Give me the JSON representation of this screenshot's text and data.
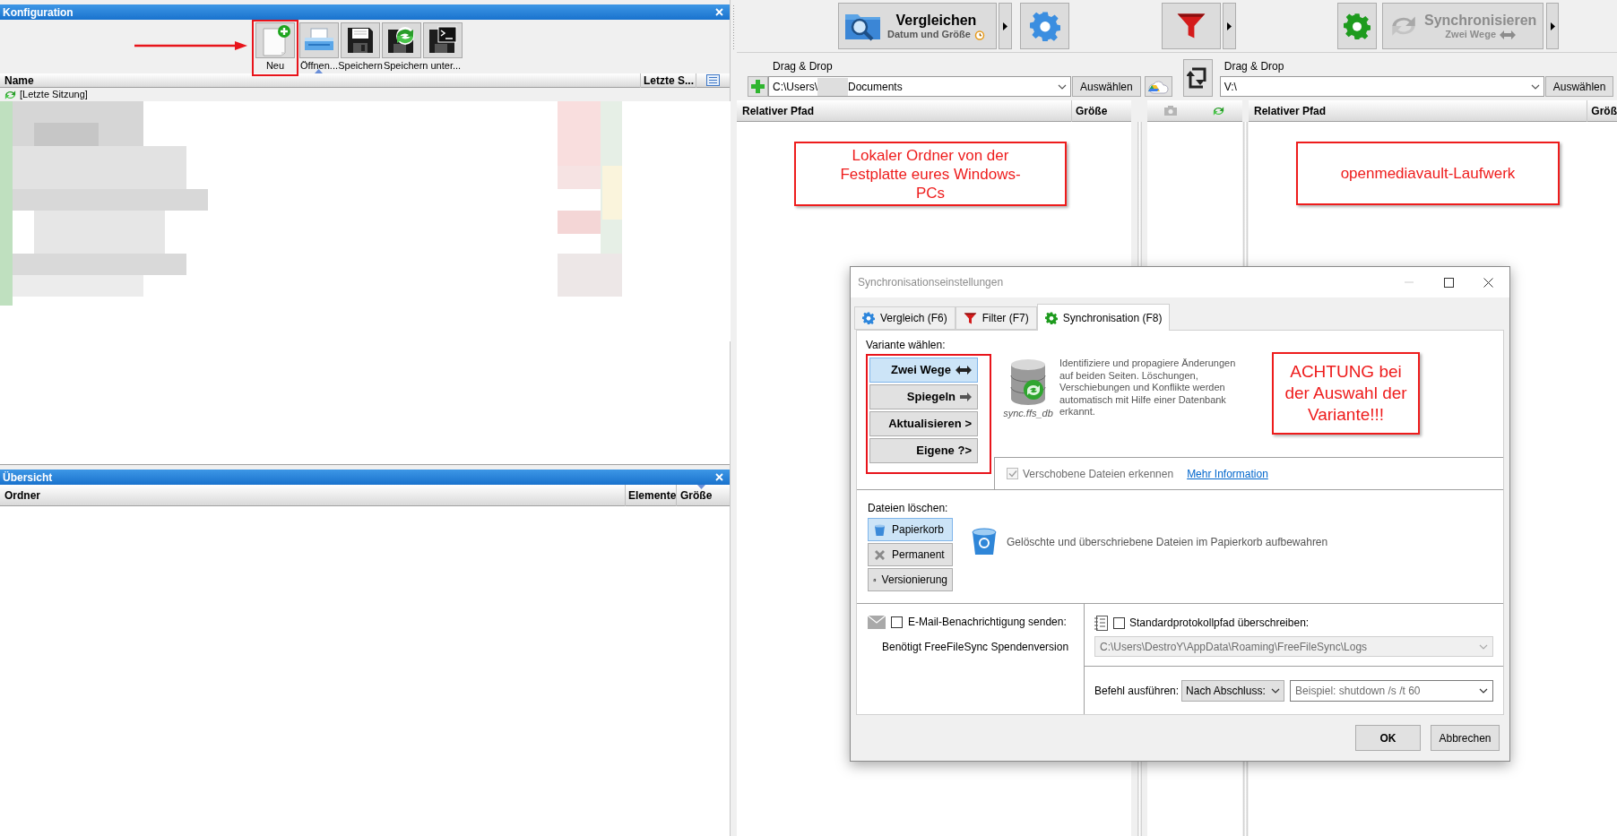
{
  "configuration_panel": {
    "title": "Konfiguration",
    "toolbar": [
      {
        "label": "Neu",
        "highlighted": true
      },
      {
        "label": "Öffnen...",
        "highlighted": false
      },
      {
        "label": "Speichern",
        "highlighted": false
      },
      {
        "label": "Speichern unter...",
        "highlighted": false
      },
      {
        "highlighted": false
      }
    ],
    "columns": [
      "Name",
      "Letzte S..."
    ],
    "rows": [
      {
        "name": "[Letzte Sitzung]"
      }
    ]
  },
  "overview_panel": {
    "title": "Übersicht",
    "columns": [
      "Ordner",
      "Elemente",
      "Größe"
    ]
  },
  "main_toolbar": {
    "compare": {
      "label": "Vergleichen",
      "sublabel": "Datum und Größe"
    },
    "synchronize": {
      "label": "Synchronisieren",
      "sublabel": "Zwei Wege",
      "disabled": true
    }
  },
  "folder_pairs": [
    {
      "label": "Drag & Drop",
      "path": "C:\\Users\\",
      "path_after_blur": "Documents",
      "button": "Auswählen"
    },
    {
      "label": "Drag & Drop",
      "path": "V:\\",
      "button": "Auswählen"
    }
  ],
  "file_columns": {
    "left": [
      "Relativer Pfad",
      "Größe"
    ],
    "right": [
      "Relativer Pfad",
      "Größ"
    ]
  },
  "annotations": [
    {
      "text": "Lokaler Ordner von der Festplatte eures Windows-PCs"
    },
    {
      "text": "openmediavault-Laufwerk"
    }
  ],
  "dialog": {
    "title": "Synchronisationseinstellungen",
    "tabs": [
      {
        "label": "Vergleich (F6)",
        "selected": false
      },
      {
        "label": "Filter (F7)",
        "selected": false
      },
      {
        "label": "Synchronisation (F8)",
        "selected": true
      }
    ],
    "variant_label": "Variante wählen:",
    "variants": [
      {
        "label": "Zwei Wege",
        "selected": true
      },
      {
        "label": "Spiegeln",
        "selected": false
      },
      {
        "label": "Aktualisieren >",
        "selected": false
      },
      {
        "label": "Eigene ?>",
        "selected": false
      }
    ],
    "database_caption": "sync.ffs_db",
    "description": "Identifiziere und propagiere Änderungen auf beiden Seiten. Löschungen, Verschiebungen und Konflikte werden automatisch mit Hilfe einer Datenbank erkannt.",
    "annotation": "ACHTUNG bei der Auswahl der Variante!!!",
    "detect_moved": {
      "label": "Verschobene Dateien erkennen",
      "checked": true,
      "disabled": true
    },
    "more_info_link": "Mehr Information",
    "delete_label": "Dateien löschen:",
    "delete_options": [
      {
        "label": "Papierkorb",
        "selected": true
      },
      {
        "label": "Permanent",
        "selected": false
      },
      {
        "label": "Versionierung",
        "selected": false
      }
    ],
    "delete_description": "Gelöschte und überschriebene Dateien im Papierkorb aufbewahren",
    "email": {
      "label": "E-Mail-Benachrichtigung senden:",
      "checked": false
    },
    "email_note": "Benötigt FreeFileSync Spendenversion",
    "log_override": {
      "label": "Standardprotokollpfad überschreiben:",
      "checked": false
    },
    "log_path": {
      "value": "C:\\Users\\DestroY\\AppData\\Roaming\\FreeFileSync\\Logs",
      "disabled": true
    },
    "command_label": "Befehl ausführen:",
    "command_timing": "Nach Abschluss:",
    "command_placeholder": "Beispiel: shutdown /s /t 60",
    "buttons": [
      "OK",
      "Abbrechen"
    ]
  }
}
